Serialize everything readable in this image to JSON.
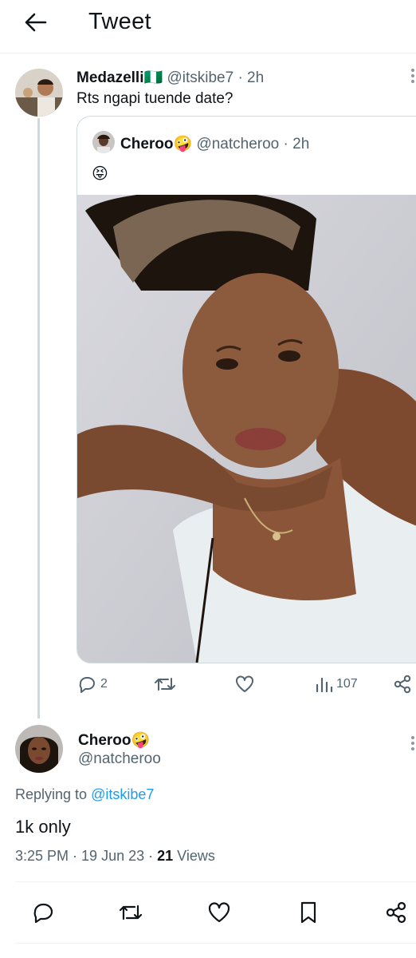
{
  "header": {
    "title": "Tweet",
    "back_icon": "arrow-left-icon"
  },
  "tweet1": {
    "author_name": "Medazelli",
    "author_flag": "🇳🇬",
    "handle": "@itskibe7",
    "time": "· 2h",
    "text": "Rts ngapi tuende date?"
  },
  "quote": {
    "author_name": "Cheroo",
    "author_emoji": "🤪",
    "handle": "@natcheroo",
    "time": "· 2h",
    "text": "😝"
  },
  "actions": {
    "replies": "2",
    "views": "107"
  },
  "tweet2": {
    "author_name": "Cheroo",
    "author_emoji": "🤪",
    "handle": "@natcheroo",
    "replying_prefix": "Replying to ",
    "replying_to": "@itskibe7",
    "text": "1k only",
    "time": "3:25 PM",
    "date": "19 Jun 23",
    "views_count": "21",
    "views_label": "Views"
  },
  "colors": {
    "link": "#1d9bf0",
    "muted": "#536471",
    "border": "#cfd9de",
    "text": "#0f1419"
  }
}
